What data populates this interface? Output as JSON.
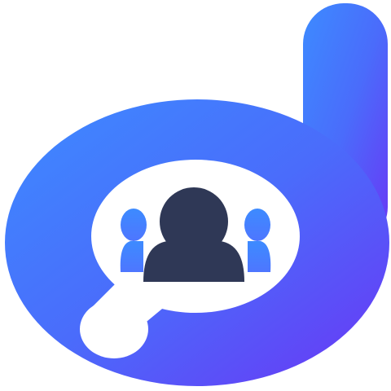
{
  "logo": {
    "name": "d-letter-people-logo",
    "icon": "d-letter-with-people-group",
    "colors": {
      "gradient_start": "#3d8bff",
      "gradient_mid": "#4a6cfb",
      "gradient_end": "#6a36f5",
      "inner_fill": "#ffffff",
      "person_center": "#2f3856",
      "person_side": "#3d8bff"
    }
  }
}
